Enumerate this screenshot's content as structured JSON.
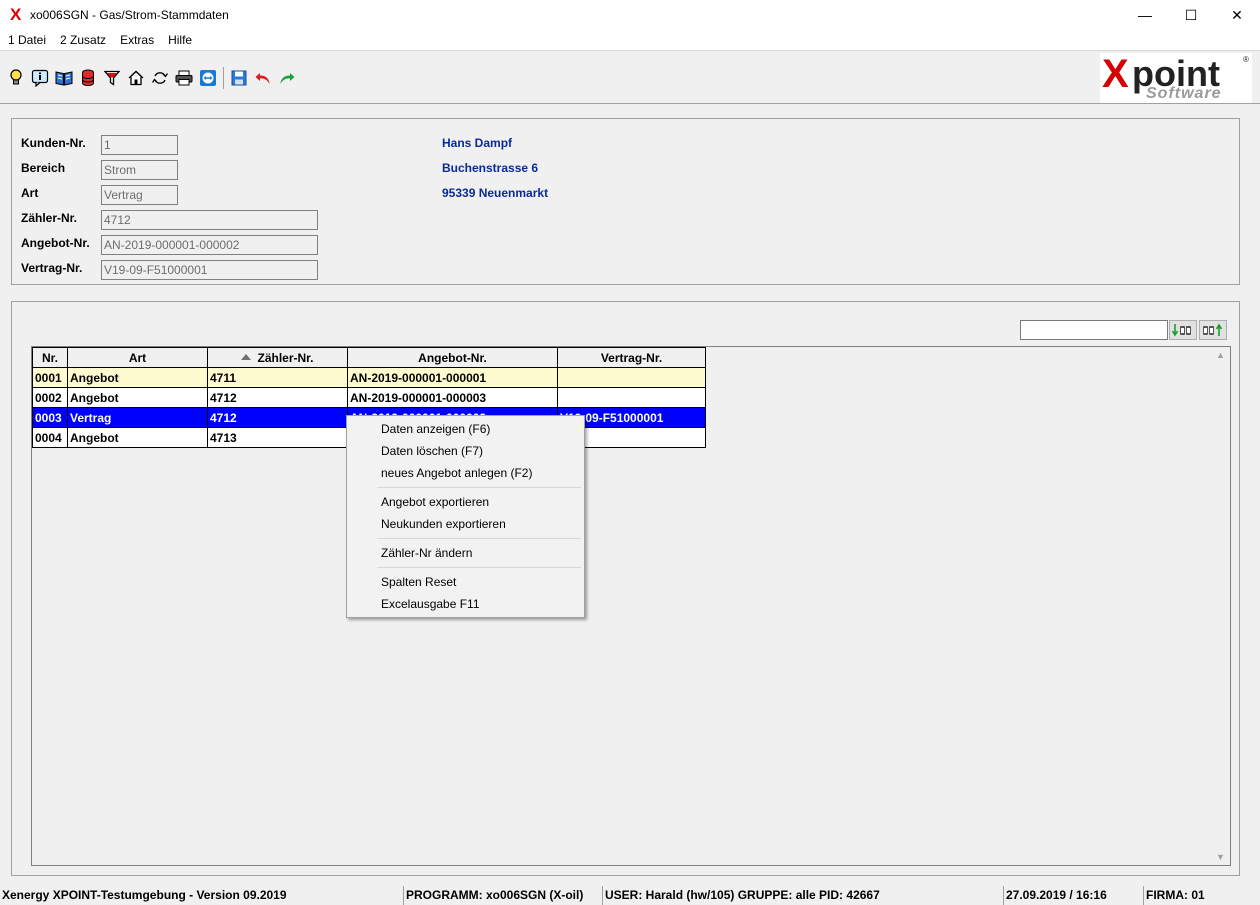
{
  "window": {
    "title": "xo006SGN - Gas/Strom-Stammdaten",
    "min": "—",
    "max": "☐",
    "close": "✕"
  },
  "menu": [
    "1 Datei",
    "2 Zusatz",
    "Extras",
    "Hilfe"
  ],
  "logo": {
    "main_x": "X",
    "main_rest": "point",
    "sub": "Software",
    "reg": "®"
  },
  "form": {
    "kunden_label": "Kunden-Nr.",
    "kunden_value": "1",
    "bereich_label": "Bereich",
    "bereich_value": "Strom",
    "art_label": "Art",
    "art_value": "Vertrag",
    "zaehler_label": "Zähler-Nr.",
    "zaehler_value": "4712",
    "angebot_label": "Angebot-Nr.",
    "angebot_value": "AN-2019-000001-000002",
    "vertrag_label": "Vertrag-Nr.",
    "vertrag_value": "V19-09-F51000001"
  },
  "address": {
    "name": "Hans Dampf",
    "street": "Buchenstrasse 6",
    "city": "95339 Neuenmarkt"
  },
  "search": {
    "value": ""
  },
  "grid": {
    "headers": [
      "Nr.",
      "Art",
      "Zähler-Nr.",
      "Angebot-Nr.",
      "Vertrag-Nr."
    ],
    "rows": [
      [
        "0001",
        "Angebot",
        "4711",
        "AN-2019-000001-000001",
        ""
      ],
      [
        "0002",
        "Angebot",
        "4712",
        "AN-2019-000001-000003",
        ""
      ],
      [
        "0003",
        "Vertrag",
        "4712",
        "AN-2019-000001-000002",
        "V19-09-F51000001"
      ],
      [
        "0004",
        "Angebot",
        "4713",
        "",
        ""
      ]
    ]
  },
  "context_menu": {
    "daten_anzeigen": "Daten anzeigen (F6)",
    "daten_loeschen": "Daten löschen (F7)",
    "neues_angebot": "neues Angebot anlegen (F2)",
    "angebot_export": "Angebot exportieren",
    "neukunden_export": "Neukunden exportieren",
    "zaehler_aendern": "Zähler-Nr ändern",
    "spalten_reset": "Spalten Reset",
    "excel": "Excelausgabe F11"
  },
  "status": {
    "env": "Xenergy XPOINT-Testumgebung - Version 09.2019",
    "program": "PROGRAMM: xo006SGN (X-oil)",
    "user": "USER: Harald (hw/105)  GRUPPE: alle  PID: 42667",
    "datetime": "27.09.2019 / 16:16",
    "firma": "FIRMA: 01"
  },
  "colors": {
    "selection": "#0000ff",
    "highlight_row": "#fffbd0",
    "address_text": "#0a2a9a",
    "logo_red": "#d50000"
  }
}
